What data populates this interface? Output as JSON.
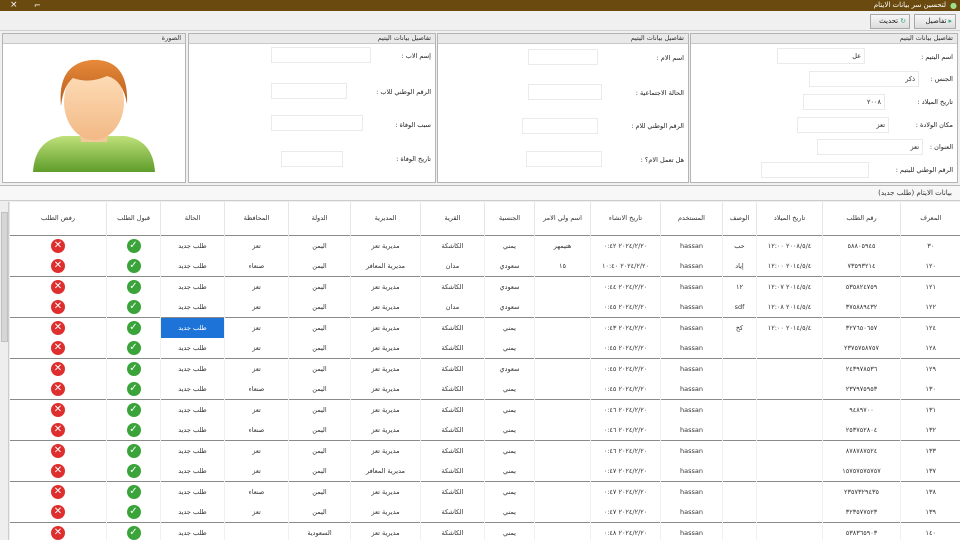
{
  "window": {
    "title": "لتحسين سر بيانات الايتام",
    "close_glyph": "×",
    "restore_glyph": "⌐"
  },
  "toolbar": {
    "details_label": "تفاصيل",
    "refresh_label": "تحديث"
  },
  "panels": {
    "orphan": {
      "header": "تفاصيل بيانات اليتيم",
      "fields": [
        {
          "label": "اسم اليتيم :",
          "value": "عل"
        },
        {
          "label": "الجنس :",
          "value": "ذكر"
        },
        {
          "label": "تاريخ الميلاد :",
          "value": "٢٠٠٨"
        },
        {
          "label": "مكان الولادة :",
          "value": "تعز"
        },
        {
          "label": "العنوان :",
          "value": "تعز"
        },
        {
          "label": "الرقم الوطني لليتيم :",
          "value": ""
        }
      ]
    },
    "mother": {
      "header": "تفاصيل بيانات اليتيم",
      "fields": [
        {
          "label": "اسم الام :",
          "value": ""
        },
        {
          "label": "الحالة الاجتماعية :",
          "value": ""
        },
        {
          "label": "الرقم الوطني للام :",
          "value": ""
        },
        {
          "label": "هل تعمل الام؟ :",
          "value": ""
        }
      ]
    },
    "father": {
      "header": "تفاصيل بيانات اليتيم",
      "fields": [
        {
          "label": "إسم الاب :",
          "value": ""
        },
        {
          "label": "الرقم الوطني للاب :",
          "value": ""
        },
        {
          "label": "سبب الوفاة :",
          "value": ""
        },
        {
          "label": "تاريخ الوفاة :",
          "value": ""
        }
      ]
    },
    "photo": {
      "header": "الصورة"
    }
  },
  "grid": {
    "caption": "بيانات الايتام (طلب جديد)",
    "columns": [
      "المعرف",
      "رقم الطلب",
      "تاريخ الميلاد",
      "الوصف",
      "المستخدم",
      "تاريخ الانشاء",
      "اسم ولي الامر",
      "الجنسية",
      "القرية",
      "المديرية",
      "الدولة",
      "المحافظة",
      "الحالة",
      "قبول الطلب",
      "رفض الطلب"
    ],
    "rows": [
      {
        "id": "٣٠",
        "req": "٥٨٨٠٥٩٤٥",
        "dob": "٢٠٠٨/٥/٤ ١٢:٠٠",
        "desc": "حب",
        "user": "hassan",
        "created": "٢٠٢٤/٢/٢٠ ٠:٤٢",
        "guardian": "هتيمهر",
        "nation": "يمني",
        "village": "الكاشكة",
        "district": "مديرية تعز",
        "country": "اليمن",
        "gov": "تعز",
        "status": "طلب جديد"
      },
      {
        "id": "١٢٠",
        "req": "٧٣٥٩٣٢١٤",
        "dob": "٢٠١٤/٥/٤ ١٢:٠٠",
        "desc": "إياد",
        "user": "hassan",
        "created": "٢٠٢٤/٢/٢٠ ١٠:٤٠",
        "guardian": "١٥",
        "nation": "سعودي",
        "village": "مدان",
        "district": "مديرية المعافر",
        "country": "اليمن",
        "gov": "صنعاء",
        "status": "طلب جديد"
      },
      {
        "id": "١٢١",
        "req": "٥٣٥٨٢٤٧٥٩",
        "dob": "٢٠١٤/٥/٤ ١٢:٠٧",
        "desc": "١٢",
        "user": "hassan",
        "created": "٢٠٢٤/٢/٢٠ ٠:٤٤",
        "guardian": "",
        "nation": "سعودي",
        "village": "الكاشكة",
        "district": "مديرية تعز",
        "country": "اليمن",
        "gov": "تعز",
        "status": "طلب جديد"
      },
      {
        "id": "١٢٢",
        "req": "٣٧٥٨٨٩٤٣٢",
        "dob": "٢٠١٤/٥/٤ ١٢:٠٨",
        "desc": "sdf",
        "user": "hassan",
        "created": "٢٠٢٤/٢/٢٠ ٠:٤٥",
        "guardian": "",
        "nation": "سعودي",
        "village": "مدان",
        "district": "مديرية تعز",
        "country": "اليمن",
        "gov": "تعز",
        "status": "طلب جديد"
      },
      {
        "id": "١٢٤",
        "req": "٣٢٧٦٥٠٦٥٧",
        "dob": "٢٠١٤/٥/٤ ١٢:٠٠",
        "desc": "كخ",
        "user": "hassan",
        "created": "٢٠٢٤/٢/٢٠ ٠:٤٣",
        "guardian": "",
        "nation": "يمني",
        "village": "الكاشكة",
        "district": "مديرية تعز",
        "country": "اليمن",
        "gov": "تعز",
        "status": "طلب جديد",
        "selected": true,
        "marker": true
      },
      {
        "id": "١٢٨",
        "req": "٢٣٧٥٧٥٨٧٥٧",
        "dob": "",
        "desc": "",
        "user": "hassan",
        "created": "٢٠٢٤/٢/٢٠ ٠:٤٥",
        "guardian": "",
        "nation": "يمني",
        "village": "الكاشكة",
        "district": "مديرية تعز",
        "country": "اليمن",
        "gov": "تعز",
        "status": "طلب جديد"
      },
      {
        "id": "١٢٩",
        "req": "٢٤٣٩٧٨٥٣٦",
        "dob": "",
        "desc": "",
        "user": "hassan",
        "created": "٢٠٢٤/٢/٢٠ ٠:٤٥",
        "guardian": "",
        "nation": "سعودي",
        "village": "الكاشكة",
        "district": "مديرية تعز",
        "country": "اليمن",
        "gov": "تعز",
        "status": "طلب جديد"
      },
      {
        "id": "١٣٠",
        "req": "٢٣٧٩٧٥٩٥٣",
        "dob": "",
        "desc": "",
        "user": "hassan",
        "created": "٢٠٢٤/٢/٢٠ ٠:٤٥",
        "guardian": "",
        "nation": "يمني",
        "village": "الكاشكة",
        "district": "مديرية تعز",
        "country": "اليمن",
        "gov": "صنعاء",
        "status": "طلب جديد"
      },
      {
        "id": "١٣١",
        "req": "٩٤٨٩٧٠٠",
        "dob": "",
        "desc": "",
        "user": "hassan",
        "created": "٢٠٢٤/٢/٢٠ ٠:٤٦",
        "guardian": "",
        "nation": "يمني",
        "village": "الكاشكة",
        "district": "مديرية تعز",
        "country": "اليمن",
        "gov": "تعز",
        "status": "طلب جديد"
      },
      {
        "id": "١٣٢",
        "req": "٢٥٣٧٥٢٨٠٤",
        "dob": "",
        "desc": "",
        "user": "hassan",
        "created": "٢٠٢٤/٢/٢٠ ٠:٤٦",
        "guardian": "",
        "nation": "يمني",
        "village": "الكاشكة",
        "district": "مديرية تعز",
        "country": "اليمن",
        "gov": "صنعاء",
        "status": "طلب جديد"
      },
      {
        "id": "١٣٣",
        "req": "٨٧٨٧٨٧٥٢٤",
        "dob": "",
        "desc": "",
        "user": "hassan",
        "created": "٢٠٢٤/٢/٢٠ ٠:٤٦",
        "guardian": "",
        "nation": "يمني",
        "village": "الكاشكة",
        "district": "مديرية تعز",
        "country": "اليمن",
        "gov": "تعز",
        "status": "طلب جديد"
      },
      {
        "id": "١٣٧",
        "req": "١٥٧٥٧٥٧٥٧٥٧",
        "dob": "",
        "desc": "",
        "user": "hassan",
        "created": "٢٠٢٤/٢/٢٠ ٠:٤٧",
        "guardian": "",
        "nation": "يمني",
        "village": "الكاشكة",
        "district": "مديرية المعافر",
        "country": "اليمن",
        "gov": "تعز",
        "status": "طلب جديد"
      },
      {
        "id": "١٣٨",
        "req": "٢٣٥٧٣٢٩٤٣٥",
        "dob": "",
        "desc": "",
        "user": "hassan",
        "created": "٢٠٢٤/٢/٢٠ ٠:٤٧",
        "guardian": "",
        "nation": "يمني",
        "village": "الكاشكة",
        "district": "مديرية تعز",
        "country": "اليمن",
        "gov": "صنعاء",
        "status": "طلب جديد"
      },
      {
        "id": "١٣٩",
        "req": "٣٢٣٥٧٧٥٢٣",
        "dob": "",
        "desc": "",
        "user": "hassan",
        "created": "٢٠٢٤/٢/٢٠ ٠:٤٧",
        "guardian": "",
        "nation": "يمني",
        "village": "الكاشكة",
        "district": "مديرية تعز",
        "country": "اليمن",
        "gov": "تعز",
        "status": "طلب جديد"
      },
      {
        "id": "١٤٠",
        "req": "٥٣٨٣٦٥٩٠٣",
        "dob": "",
        "desc": "",
        "user": "hassan",
        "created": "٢٠٢٤/٢/٢٠ ٠:٤٨",
        "guardian": "",
        "nation": "يمني",
        "village": "الكاشكة",
        "district": "مديرية تعز",
        "country": "السعودية",
        "gov": "",
        "status": "طلب جديد"
      }
    ],
    "accept_glyph": "✓",
    "reject_glyph": "✕",
    "row_marker_glyph": "▸"
  },
  "colors": {
    "titlebar": "#6b4a0f",
    "accept": "#3aa33a",
    "reject": "#de2e2e",
    "selection": "#1e73d8"
  }
}
